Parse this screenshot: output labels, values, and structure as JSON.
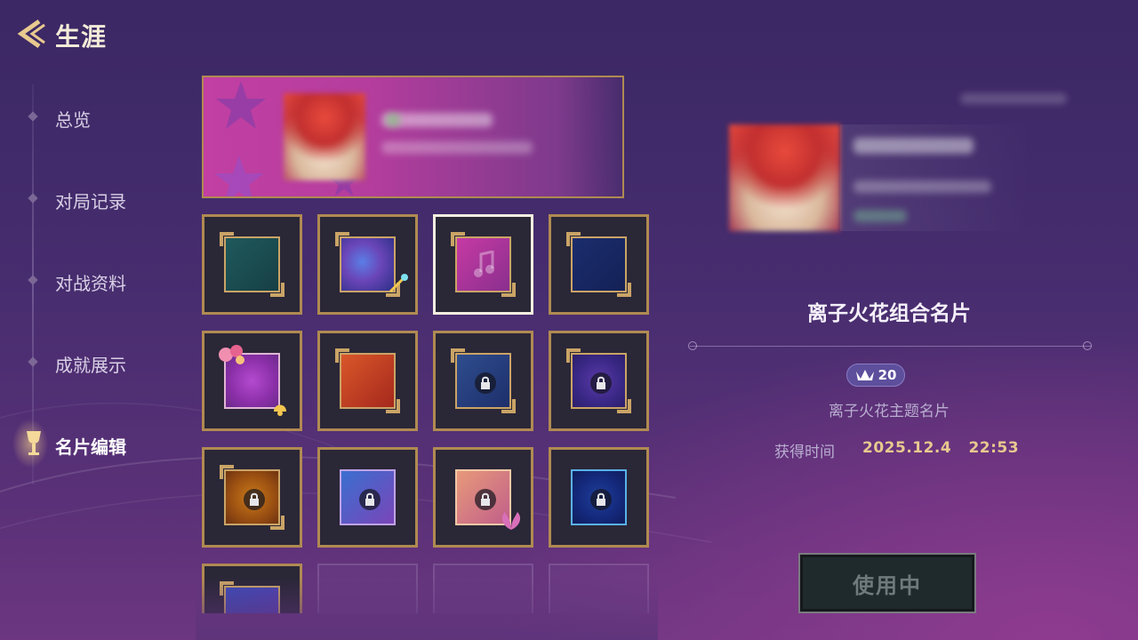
{
  "header": {
    "title": "生涯",
    "back_icon": "chevron-left-icon"
  },
  "sidebar": {
    "items": [
      {
        "label": "总览",
        "active": false
      },
      {
        "label": "对局记录",
        "active": false
      },
      {
        "label": "对战资料",
        "active": false
      },
      {
        "label": "成就展示",
        "active": false
      },
      {
        "label": "名片编辑",
        "active": true,
        "icon": "trophy-icon"
      }
    ]
  },
  "cards": {
    "tiles": [
      {
        "theme": "teal",
        "locked": false,
        "selected": false
      },
      {
        "theme": "cosmic-blue",
        "locked": false,
        "selected": false
      },
      {
        "theme": "magenta-music",
        "locked": false,
        "selected": true
      },
      {
        "theme": "navy",
        "locked": false,
        "selected": false
      },
      {
        "theme": "pink-rose",
        "locked": false,
        "selected": false
      },
      {
        "theme": "red-orange",
        "locked": false,
        "selected": false
      },
      {
        "theme": "blue-gold",
        "locked": true,
        "selected": false
      },
      {
        "theme": "violet-green",
        "locked": true,
        "selected": false
      },
      {
        "theme": "amber",
        "locked": true,
        "selected": false
      },
      {
        "theme": "indigo-cyan",
        "locked": true,
        "selected": false
      },
      {
        "theme": "peach-pink",
        "locked": true,
        "selected": false
      },
      {
        "theme": "deep-blue-wave",
        "locked": true,
        "selected": false
      },
      {
        "theme": "blue-violet",
        "locked": true,
        "selected": false
      }
    ]
  },
  "detail": {
    "title": "离子火花组合名片",
    "cost": "20",
    "cost_icon": "crown-icon",
    "description": "离子火花主题名片",
    "acquired_label": "获得时间",
    "acquired_value": "2025.12.4   22:53",
    "status_button": "使用中"
  },
  "colors": {
    "frame_gold": "#b08a52",
    "selected_frame": "#f6eee0",
    "acquired_text": "#e8c98f",
    "badge_bg": "#5d4f9c"
  }
}
